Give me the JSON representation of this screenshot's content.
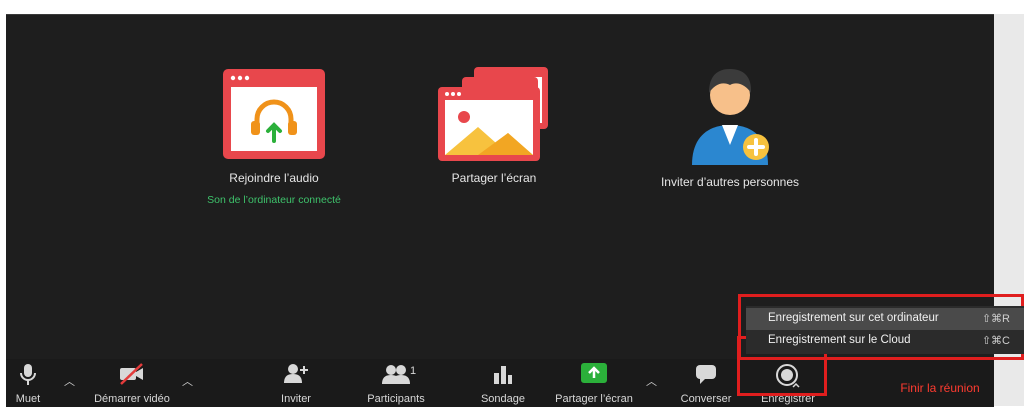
{
  "actions": {
    "audio": {
      "label": "Rejoindre l’audio",
      "sub": "Son de l’ordinateur connecté",
      "icon": "headphones-icon"
    },
    "share": {
      "label": "Partager l’écran",
      "icon": "share-screen-icon"
    },
    "invite": {
      "label": "Inviter d’autres personnes",
      "icon": "person-add-icon"
    }
  },
  "toolbar": {
    "mute": "Muet",
    "video": "Démarrer vidéo",
    "invite": "Inviter",
    "participants": "Participants",
    "participants_count": "1",
    "poll": "Sondage",
    "share": "Partager l’écran",
    "chat": "Converser",
    "record": "Enregistrer",
    "end": "Finir la réunion"
  },
  "record_menu": {
    "items": [
      {
        "label": "Enregistrement sur cet ordinateur",
        "shortcut": "⇧⌘R"
      },
      {
        "label": "Enregistrement sur le Cloud",
        "shortcut": "⇧⌘C"
      }
    ]
  },
  "colors": {
    "background": "#1e1e1e",
    "accent_red": "#e8474c",
    "share_green": "#2bb03a",
    "end_red": "#ff3b30",
    "connected_green": "#3ec26b"
  }
}
